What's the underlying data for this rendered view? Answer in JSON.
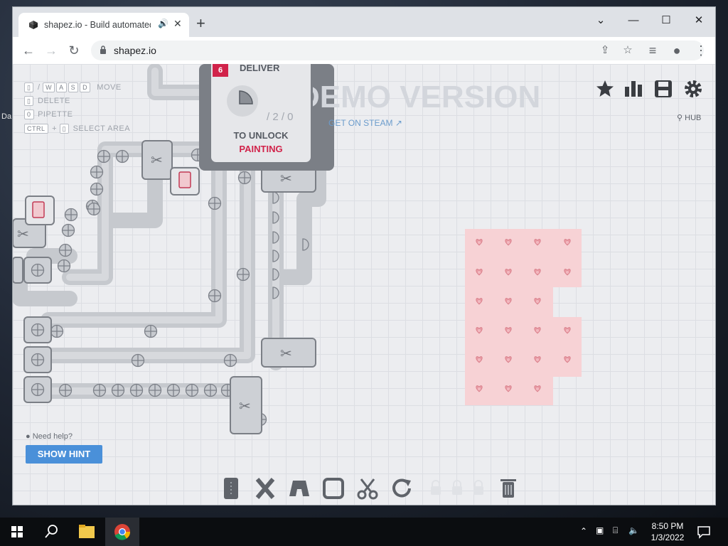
{
  "browser": {
    "tab_title": "shapez.io - Build automated",
    "url": "shapez.io"
  },
  "game": {
    "keybindings": [
      {
        "keys": [
          "/",
          "W",
          "A",
          "S",
          "D"
        ],
        "action": "MOVE"
      },
      {
        "keys": [],
        "action": "DELETE"
      },
      {
        "keys": [
          "0"
        ],
        "action": "PIPETTE"
      },
      {
        "keys": [
          "CTRL",
          "+"
        ],
        "action": "SELECT AREA"
      }
    ],
    "banner": "DEMO VERSION",
    "get_on_steam": "GET ON STEAM",
    "hub_label": "HUB",
    "level": {
      "number": "6",
      "deliver_label": "DELIVER",
      "progress": "/ 2 / 0",
      "to_unlock_label": "TO UNLOCK",
      "reward": "PAINTING"
    },
    "help": {
      "question": "Need help?",
      "button": "SHOW HINT"
    },
    "top_icons": [
      "star-icon",
      "statistics-icon",
      "save-icon",
      "settings-icon"
    ],
    "hotbar": [
      "belt-tool",
      "balancer-tool",
      "tunnel-tool",
      "extractor-tool",
      "cutter-tool",
      "rotator-tool",
      "locked-slot",
      "locked-slot",
      "locked-slot",
      "trash-tool"
    ],
    "colors": {
      "accent_red": "#d1234a",
      "hint_blue": "#4a90d9",
      "paint_zone": "#f7d2d5",
      "heart_shape": "#e89aa3"
    }
  },
  "taskbar": {
    "time": "8:50 PM",
    "date": "1/3/2022"
  }
}
